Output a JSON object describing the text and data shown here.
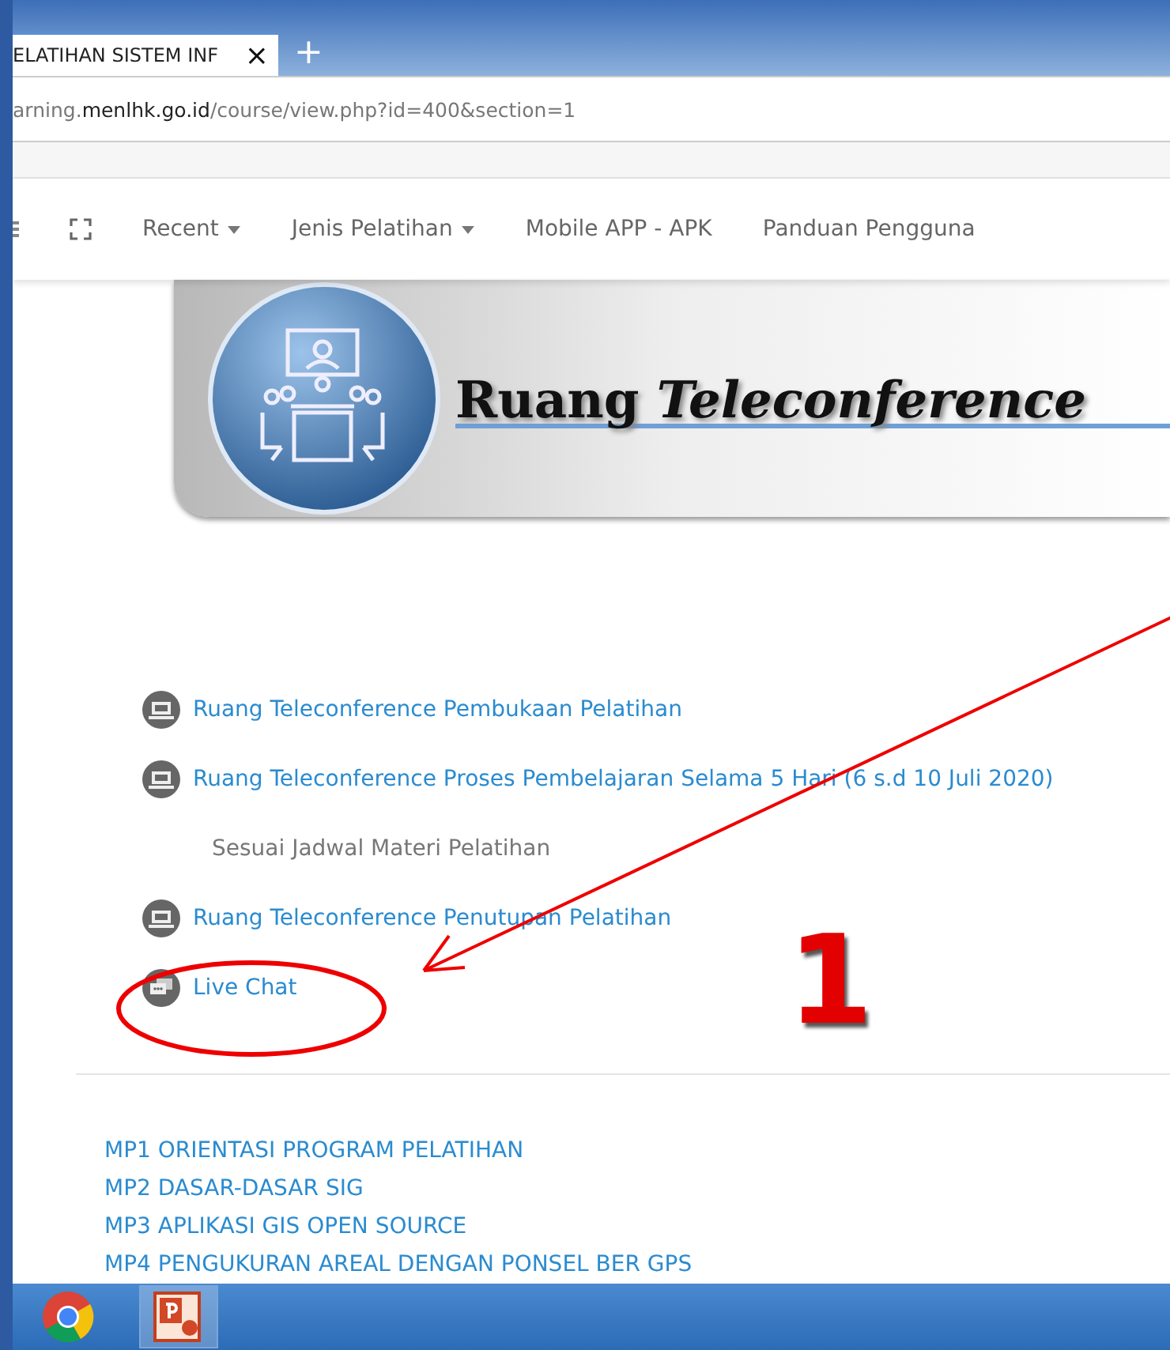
{
  "browser": {
    "tab": {
      "label": "ELATIHAN SISTEM INF",
      "close": "×",
      "selected": true
    },
    "new_tab": "+",
    "address": {
      "prefix": "arning.",
      "domain": "menlhk.go.id",
      "path": "/course/view.php?id=400&section=1"
    }
  },
  "navbar": {
    "items": [
      {
        "label": "Recent",
        "dropdown": true
      },
      {
        "label": "Jenis Pelatihan",
        "dropdown": true
      },
      {
        "label": "Mobile APP - APK",
        "dropdown": false
      },
      {
        "label": "Panduan Pengguna",
        "dropdown": false
      }
    ]
  },
  "banner": {
    "title": "Ruang *Teleconference*"
  },
  "activities": [
    {
      "kind": "conference",
      "label": "Ruang Teleconference Pembukaan Pelatihan"
    },
    {
      "kind": "conference",
      "label": "Ruang Teleconference Proses Pembelajaran Selama 5 Hari (6 s.d 10 Juli 2020)"
    },
    {
      "kind": "note",
      "label": "Sesuai Jadwal Materi Pelatihan"
    },
    {
      "kind": "conference",
      "label": "Ruang Teleconference Penutupan Pelatihan"
    },
    {
      "kind": "chat",
      "label": "Live Chat"
    }
  ],
  "annotation": {
    "number": "1"
  },
  "sections": [
    "MP1 ORIENTASI PROGRAM PELATIHAN",
    "MP2 DASAR-DASAR SIG",
    "MP3 APLIKASI GIS OPEN SOURCE",
    "MP4 PENGUKURAN AREAL DENGAN PONSEL BER GPS"
  ]
}
